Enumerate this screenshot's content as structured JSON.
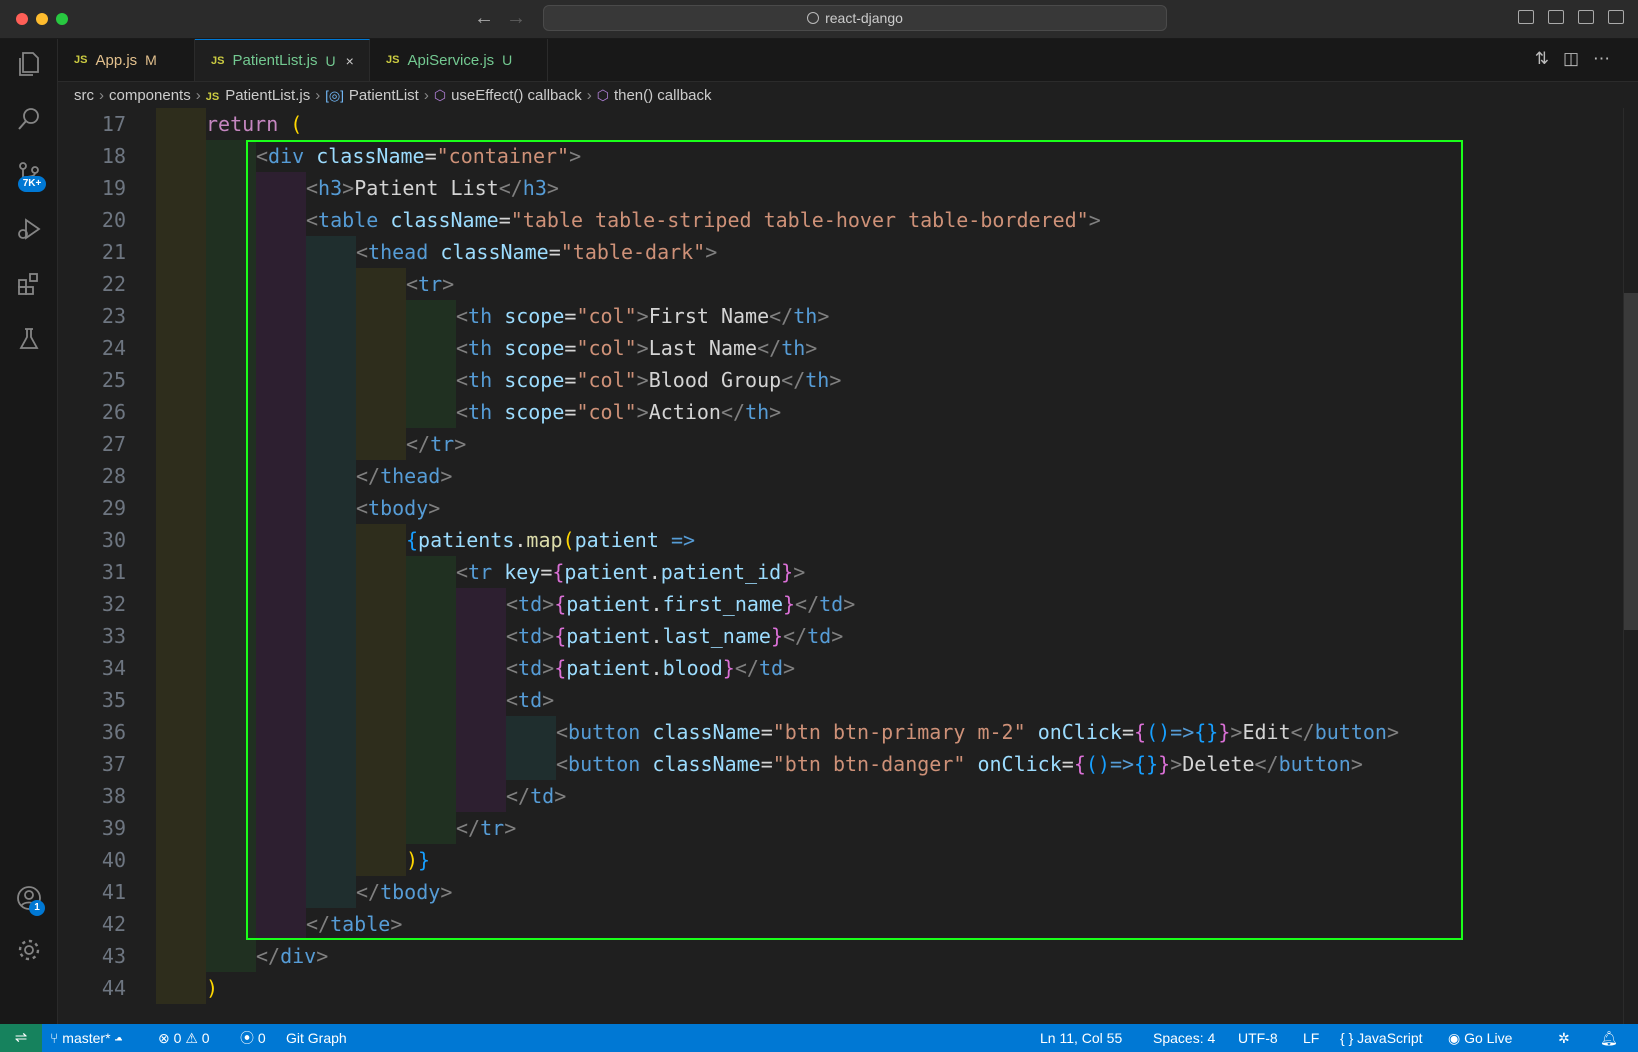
{
  "window": {
    "title": "react-django",
    "traffic_lights": [
      "#ff5f57",
      "#febc2e",
      "#28c840"
    ]
  },
  "activity_bar": {
    "items": [
      {
        "icon": "files-icon"
      },
      {
        "icon": "search-icon"
      },
      {
        "icon": "source-control-icon",
        "badge": "7K+"
      },
      {
        "icon": "run-debug-icon"
      },
      {
        "icon": "extensions-icon"
      },
      {
        "icon": "testing-icon"
      }
    ],
    "bottom": [
      {
        "icon": "account-icon",
        "badge": "1"
      },
      {
        "icon": "settings-gear-icon"
      }
    ]
  },
  "tabs": [
    {
      "lang": "JS",
      "name": "App.js",
      "status": "M",
      "active": false,
      "status_color": "#e2c08d"
    },
    {
      "lang": "JS",
      "name": "PatientList.js",
      "status": "U",
      "active": true,
      "status_color": "#73c991",
      "close": "×"
    },
    {
      "lang": "JS",
      "name": "ApiService.js",
      "status": "U",
      "active": false,
      "status_color": "#73c991"
    }
  ],
  "breadcrumb": {
    "folder1": "src",
    "folder2": "components",
    "file_lang": "JS",
    "file": "PatientList.js",
    "symbol1": "PatientList",
    "symbol2": "useEffect() callback",
    "symbol3": "then() callback"
  },
  "editor": {
    "line_numbers": [
      "17",
      "18",
      "19",
      "20",
      "21",
      "22",
      "23",
      "24",
      "25",
      "26",
      "27",
      "28",
      "29",
      "30",
      "31",
      "32",
      "33",
      "34",
      "35",
      "36",
      "37",
      "38",
      "39",
      "40",
      "41",
      "42",
      "43",
      "44"
    ],
    "lines": [
      [
        [
          "kw",
          "return"
        ],
        [
          "op",
          " "
        ],
        [
          "b1",
          "("
        ]
      ],
      [
        [
          "tagp",
          "<"
        ],
        [
          "tag",
          "div"
        ],
        [
          "op",
          " "
        ],
        [
          "attr",
          "className"
        ],
        [
          "op",
          "="
        ],
        [
          "str",
          "\"container\""
        ],
        [
          "tagp",
          ">"
        ]
      ],
      [
        [
          "tagp",
          "<"
        ],
        [
          "tag",
          "h3"
        ],
        [
          "tagp",
          ">"
        ],
        [
          "txt",
          "Patient List"
        ],
        [
          "tagp",
          "</"
        ],
        [
          "tag",
          "h3"
        ],
        [
          "tagp",
          ">"
        ]
      ],
      [
        [
          "tagp",
          "<"
        ],
        [
          "tag",
          "table"
        ],
        [
          "op",
          " "
        ],
        [
          "attr",
          "className"
        ],
        [
          "op",
          "="
        ],
        [
          "str",
          "\"table table-striped table-hover table-bordered\""
        ],
        [
          "tagp",
          ">"
        ]
      ],
      [
        [
          "tagp",
          "<"
        ],
        [
          "tag",
          "thead"
        ],
        [
          "op",
          " "
        ],
        [
          "attr",
          "className"
        ],
        [
          "op",
          "="
        ],
        [
          "str",
          "\"table-dark\""
        ],
        [
          "tagp",
          ">"
        ]
      ],
      [
        [
          "tagp",
          "<"
        ],
        [
          "tag",
          "tr"
        ],
        [
          "tagp",
          ">"
        ]
      ],
      [
        [
          "tagp",
          "<"
        ],
        [
          "tag",
          "th"
        ],
        [
          "op",
          " "
        ],
        [
          "attr",
          "scope"
        ],
        [
          "op",
          "="
        ],
        [
          "str",
          "\"col\""
        ],
        [
          "tagp",
          ">"
        ],
        [
          "txt",
          "First Name"
        ],
        [
          "tagp",
          "</"
        ],
        [
          "tag",
          "th"
        ],
        [
          "tagp",
          ">"
        ]
      ],
      [
        [
          "tagp",
          "<"
        ],
        [
          "tag",
          "th"
        ],
        [
          "op",
          " "
        ],
        [
          "attr",
          "scope"
        ],
        [
          "op",
          "="
        ],
        [
          "str",
          "\"col\""
        ],
        [
          "tagp",
          ">"
        ],
        [
          "txt",
          "Last Name"
        ],
        [
          "tagp",
          "</"
        ],
        [
          "tag",
          "th"
        ],
        [
          "tagp",
          ">"
        ]
      ],
      [
        [
          "tagp",
          "<"
        ],
        [
          "tag",
          "th"
        ],
        [
          "op",
          " "
        ],
        [
          "attr",
          "scope"
        ],
        [
          "op",
          "="
        ],
        [
          "str",
          "\"col\""
        ],
        [
          "tagp",
          ">"
        ],
        [
          "txt",
          "Blood Group"
        ],
        [
          "tagp",
          "</"
        ],
        [
          "tag",
          "th"
        ],
        [
          "tagp",
          ">"
        ]
      ],
      [
        [
          "tagp",
          "<"
        ],
        [
          "tag",
          "th"
        ],
        [
          "op",
          " "
        ],
        [
          "attr",
          "scope"
        ],
        [
          "op",
          "="
        ],
        [
          "str",
          "\"col\""
        ],
        [
          "tagp",
          ">"
        ],
        [
          "txt",
          "Action"
        ],
        [
          "tagp",
          "</"
        ],
        [
          "tag",
          "th"
        ],
        [
          "tagp",
          ">"
        ]
      ],
      [
        [
          "tagp",
          "</"
        ],
        [
          "tag",
          "tr"
        ],
        [
          "tagp",
          ">"
        ]
      ],
      [
        [
          "tagp",
          "</"
        ],
        [
          "tag",
          "thead"
        ],
        [
          "tagp",
          ">"
        ]
      ],
      [
        [
          "tagp",
          "<"
        ],
        [
          "tag",
          "tbody"
        ],
        [
          "tagp",
          ">"
        ]
      ],
      [
        [
          "b3",
          "{"
        ],
        [
          "var",
          "patients"
        ],
        [
          "op",
          "."
        ],
        [
          "fn",
          "map"
        ],
        [
          "b1",
          "("
        ],
        [
          "var",
          "patient"
        ],
        [
          "op",
          " "
        ],
        [
          "tag",
          "=>"
        ]
      ],
      [
        [
          "tagp",
          "<"
        ],
        [
          "tag",
          "tr"
        ],
        [
          "op",
          " "
        ],
        [
          "attr",
          "key"
        ],
        [
          "op",
          "="
        ],
        [
          "b2",
          "{"
        ],
        [
          "var",
          "patient"
        ],
        [
          "op",
          "."
        ],
        [
          "var",
          "patient_id"
        ],
        [
          "b2",
          "}"
        ],
        [
          "tagp",
          ">"
        ]
      ],
      [
        [
          "tagp",
          "<"
        ],
        [
          "tag",
          "td"
        ],
        [
          "tagp",
          ">"
        ],
        [
          "b2",
          "{"
        ],
        [
          "var",
          "patient"
        ],
        [
          "op",
          "."
        ],
        [
          "var",
          "first_name"
        ],
        [
          "b2",
          "}"
        ],
        [
          "tagp",
          "</"
        ],
        [
          "tag",
          "td"
        ],
        [
          "tagp",
          ">"
        ]
      ],
      [
        [
          "tagp",
          "<"
        ],
        [
          "tag",
          "td"
        ],
        [
          "tagp",
          ">"
        ],
        [
          "b2",
          "{"
        ],
        [
          "var",
          "patient"
        ],
        [
          "op",
          "."
        ],
        [
          "var",
          "last_name"
        ],
        [
          "b2",
          "}"
        ],
        [
          "tagp",
          "</"
        ],
        [
          "tag",
          "td"
        ],
        [
          "tagp",
          ">"
        ]
      ],
      [
        [
          "tagp",
          "<"
        ],
        [
          "tag",
          "td"
        ],
        [
          "tagp",
          ">"
        ],
        [
          "b2",
          "{"
        ],
        [
          "var",
          "patient"
        ],
        [
          "op",
          "."
        ],
        [
          "var",
          "blood"
        ],
        [
          "b2",
          "}"
        ],
        [
          "tagp",
          "</"
        ],
        [
          "tag",
          "td"
        ],
        [
          "tagp",
          ">"
        ]
      ],
      [
        [
          "tagp",
          "<"
        ],
        [
          "tag",
          "td"
        ],
        [
          "tagp",
          ">"
        ]
      ],
      [
        [
          "tagp",
          "<"
        ],
        [
          "tag",
          "button"
        ],
        [
          "op",
          " "
        ],
        [
          "attr",
          "className"
        ],
        [
          "op",
          "="
        ],
        [
          "str",
          "\"btn btn-primary m-2\""
        ],
        [
          "op",
          " "
        ],
        [
          "attr",
          "onClick"
        ],
        [
          "op",
          "="
        ],
        [
          "b2",
          "{"
        ],
        [
          "b3",
          "()"
        ],
        [
          "tag",
          "=>"
        ],
        [
          "b3",
          "{}"
        ],
        [
          "b2",
          "}"
        ],
        [
          "tagp",
          ">"
        ],
        [
          "txt",
          "Edit"
        ],
        [
          "tagp",
          "</"
        ],
        [
          "tag",
          "button"
        ],
        [
          "tagp",
          ">"
        ]
      ],
      [
        [
          "tagp",
          "<"
        ],
        [
          "tag",
          "button"
        ],
        [
          "op",
          " "
        ],
        [
          "attr",
          "className"
        ],
        [
          "op",
          "="
        ],
        [
          "str",
          "\"btn btn-danger\""
        ],
        [
          "op",
          " "
        ],
        [
          "attr",
          "onClick"
        ],
        [
          "op",
          "="
        ],
        [
          "b2",
          "{"
        ],
        [
          "b3",
          "()"
        ],
        [
          "tag",
          "=>"
        ],
        [
          "b3",
          "{}"
        ],
        [
          "b2",
          "}"
        ],
        [
          "tagp",
          ">"
        ],
        [
          "txt",
          "Delete"
        ],
        [
          "tagp",
          "</"
        ],
        [
          "tag",
          "button"
        ],
        [
          "tagp",
          ">"
        ]
      ],
      [
        [
          "tagp",
          "</"
        ],
        [
          "tag",
          "td"
        ],
        [
          "tagp",
          ">"
        ]
      ],
      [
        [
          "tagp",
          "</"
        ],
        [
          "tag",
          "tr"
        ],
        [
          "tagp",
          ">"
        ]
      ],
      [
        [
          "b1",
          ")"
        ],
        [
          "b3",
          "}"
        ]
      ],
      [
        [
          "tagp",
          "</"
        ],
        [
          "tag",
          "tbody"
        ],
        [
          "tagp",
          ">"
        ]
      ],
      [
        [
          "tagp",
          "</"
        ],
        [
          "tag",
          "table"
        ],
        [
          "tagp",
          ">"
        ]
      ],
      [
        [
          "tagp",
          "</"
        ],
        [
          "tag",
          "div"
        ],
        [
          "tagp",
          ">"
        ]
      ],
      [
        [
          "b1",
          ")"
        ]
      ]
    ],
    "indent_levels": [
      1,
      2,
      3,
      3,
      4,
      5,
      6,
      6,
      6,
      6,
      5,
      4,
      4,
      5,
      6,
      7,
      7,
      7,
      7,
      8,
      8,
      7,
      6,
      5,
      4,
      3,
      2,
      1
    ],
    "highlight_color": "#1aff1a"
  },
  "status_bar": {
    "branch": "master*",
    "errors": "0",
    "warnings": "0",
    "ports": "0",
    "git_graph": "Git Graph",
    "position": "Ln 11, Col 55",
    "spaces": "Spaces: 4",
    "encoding": "UTF-8",
    "eol": "LF",
    "language": "JavaScript",
    "go_live": "Go Live",
    "background": "#0078d4"
  }
}
